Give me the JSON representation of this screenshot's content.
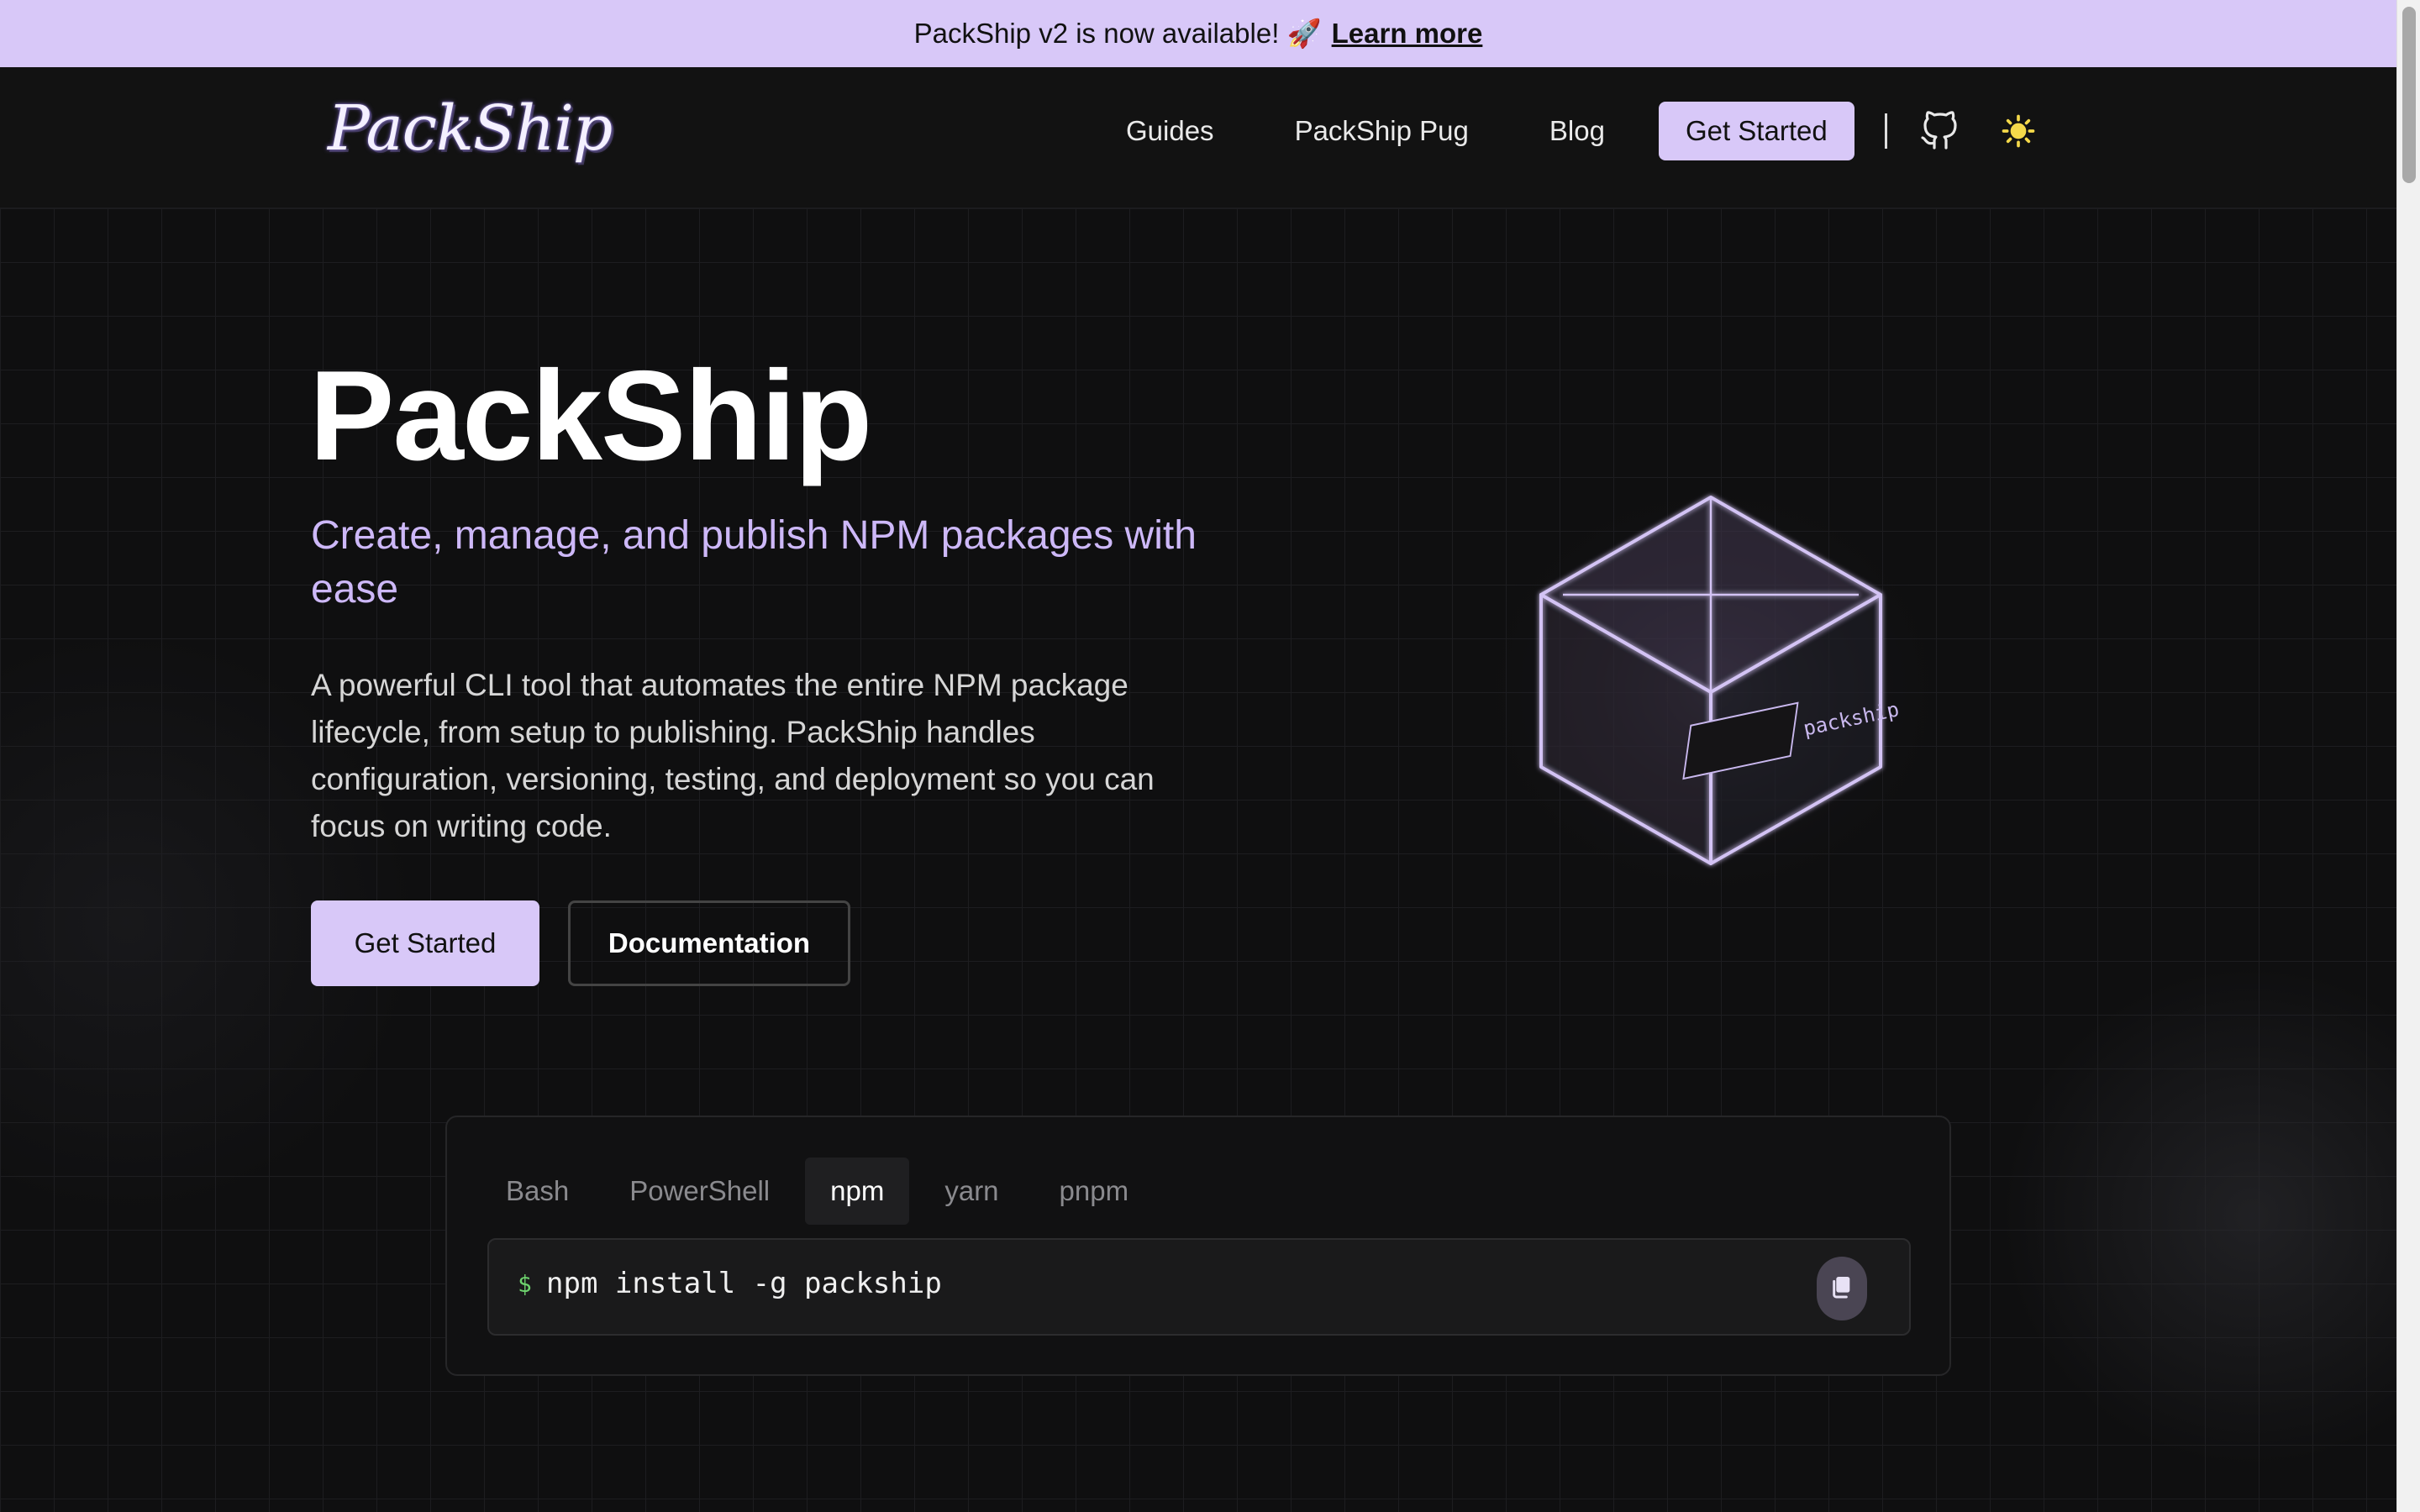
{
  "announcement": {
    "text": "PackShip v2 is now available! 🚀",
    "link_label": "Learn more"
  },
  "nav": {
    "logo": "PackShip",
    "links": [
      "Guides",
      "PackShip Pug",
      "Blog"
    ],
    "cta_label": "Get Started",
    "icons": [
      "github-icon",
      "sun-icon"
    ]
  },
  "hero": {
    "title": "PackShip",
    "subtitle": "Create, manage, and publish NPM packages with ease",
    "description": "A powerful CLI tool that automates the entire NPM package lifecycle, from setup to publishing. PackShip handles configuration, versioning, testing, and deployment so you can focus on writing code.",
    "primary_button": "Get Started",
    "secondary_button": "Documentation",
    "illustration_label": "packship"
  },
  "install": {
    "tabs": [
      "Bash",
      "PowerShell",
      "npm",
      "yarn",
      "pnpm"
    ],
    "active_tab": "npm",
    "prompt": "$",
    "command": "npm install -g packship",
    "copy_icon": "copy-icon"
  },
  "colors": {
    "accent": "#d8c8f8",
    "subtitle": "#cdb8f8",
    "background": "#0f0f10",
    "prompt": "#6ed36e"
  }
}
